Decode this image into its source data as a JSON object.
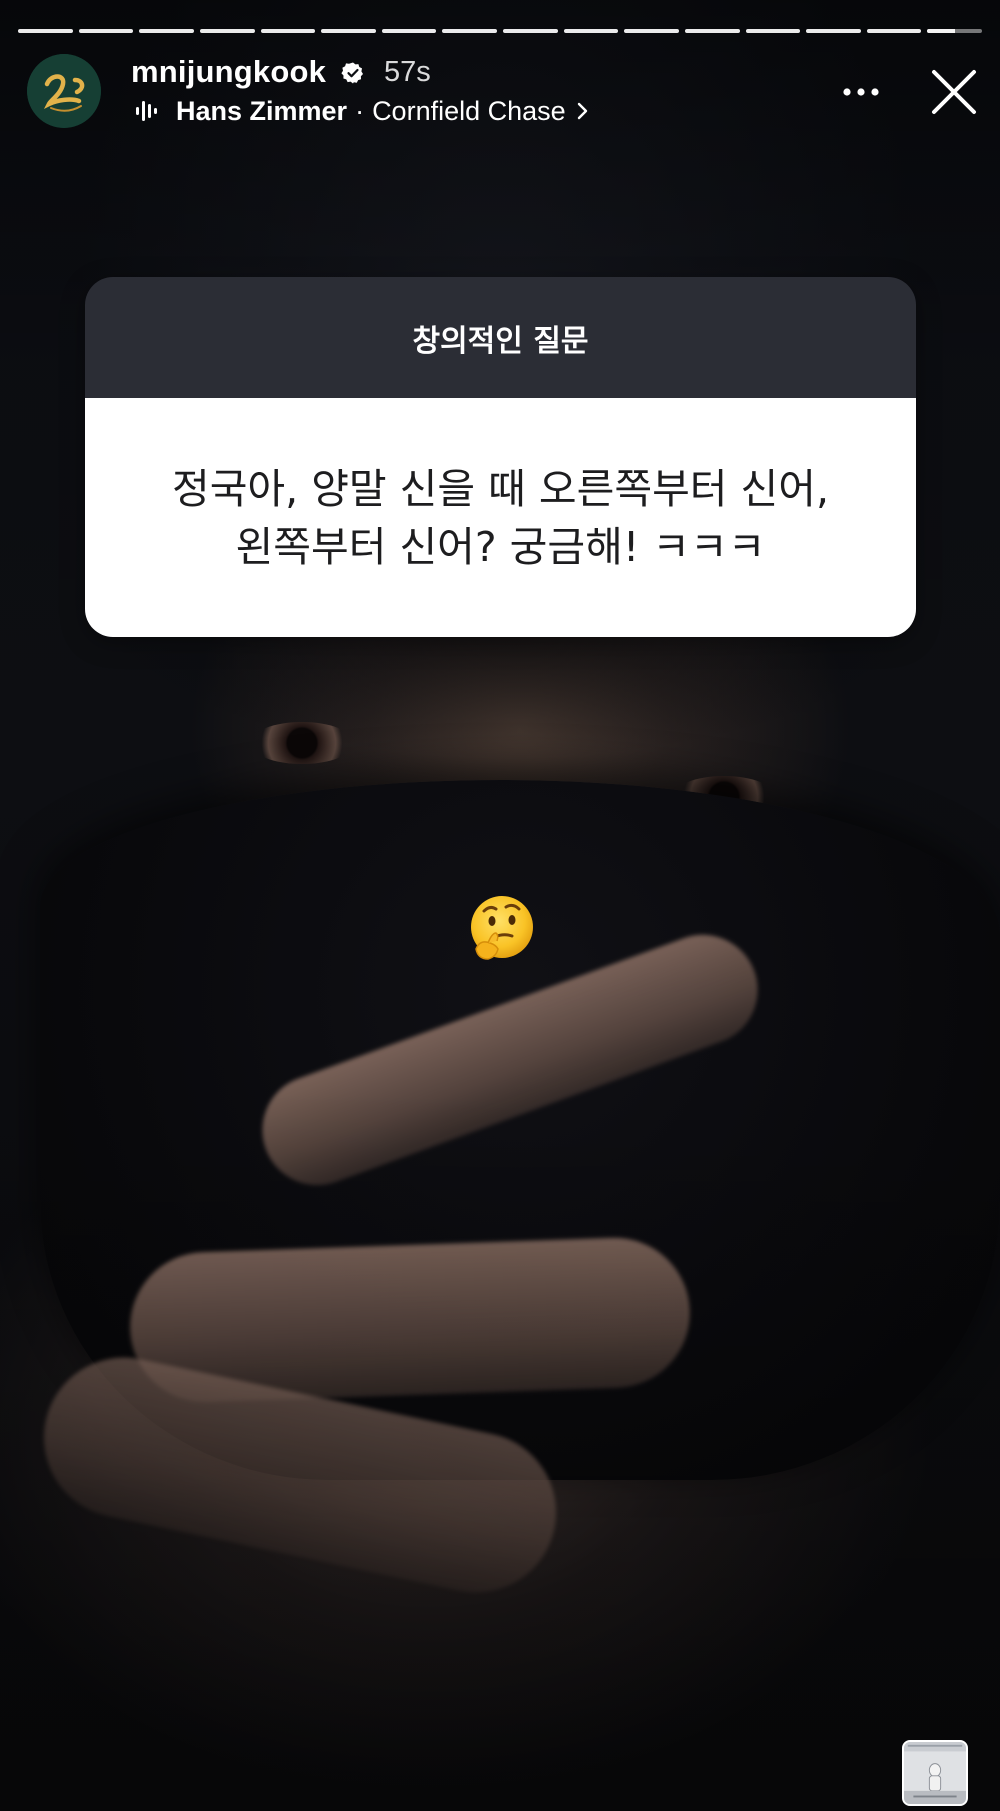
{
  "story": {
    "progress": {
      "segments_total": 16,
      "segments_completed": 15,
      "current_segment_fraction": 0.5
    },
    "account": {
      "username": "mnijungkook",
      "verified": true,
      "time_ago": "57s",
      "avatar_icon": "profile-avatar"
    },
    "music": {
      "icon": "audio-bars-icon",
      "artist": "Hans Zimmer",
      "separator": "·",
      "song": "Cornfield Chase"
    },
    "controls": {
      "more_icon": "more-options-icon",
      "close_icon": "close-icon"
    },
    "question_sticker": {
      "header": "창의적인 질문",
      "question_lines": [
        "정국아, 양말 신을 때 오른쪽부터 신어,",
        "왼쪽부터 신어? 궁금해! ㅋㅋㅋ"
      ]
    },
    "reaction_sticker": {
      "emoji": "thinking-face-emoji"
    },
    "music_cover": {
      "icon": "album-cover-thumbnail"
    }
  },
  "colors": {
    "card_header_bg": "#2b2d35",
    "card_body_bg": "#ffffff",
    "verified_blue": "#ffffff",
    "avatar_bg": "#1a4a3d"
  }
}
